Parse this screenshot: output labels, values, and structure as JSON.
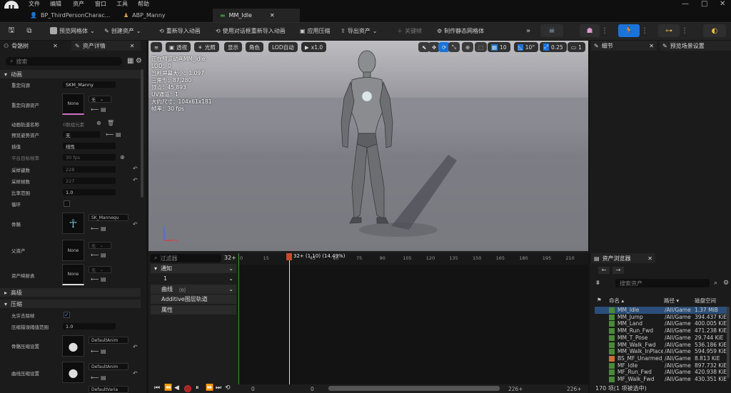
{
  "menubar": {
    "items": [
      "文件",
      "编辑",
      "资产",
      "窗口",
      "工具",
      "帮助"
    ]
  },
  "tabs": [
    {
      "label": "BP_ThirdPersonCharac..."
    },
    {
      "label": "ABP_Manny"
    },
    {
      "label": "MM_Idle"
    }
  ],
  "toolbar": {
    "preview_mesh": "预览网格体",
    "create_asset": "创建资产",
    "reimport": "重新导入动画",
    "reimport_dialog": "使用对话框重新导入动画",
    "apply_compression": "应用压缩",
    "export_asset": "导出资产",
    "add_key": "关键帧",
    "make_static_mesh": "制作静态网格体"
  },
  "left_panel": {
    "tab1": "骨骼树",
    "tab2": "资产详情",
    "search_placeholder": "搜索",
    "sections": {
      "animation": "动画",
      "advanced": "高级",
      "compression": "压缩"
    },
    "rows": {
      "retarget_source": "重定向源",
      "retarget_source_val": "SKM_Manny",
      "retarget_source_asset": "重定向源资产",
      "none": "None",
      "none_dd": "无",
      "anim_track_names": "动画轨道名称",
      "anim_track_val": "0数组元素",
      "preview_pose_asset": "预览姿势资产",
      "preview_pose_val": "无",
      "interpolation": "插值",
      "interpolation_val": "线性",
      "platform_target_frame_rate": "平台目标帧率",
      "platform_frame_val": "30 fps",
      "sampled_keys": "采样键数",
      "sampled_keys_val": "228",
      "sampled_frames": "采样帧数",
      "sampled_frames_val": "227",
      "rate_scale": "比率范围",
      "rate_scale_val": "1.0",
      "loop": "循环",
      "skeleton": "骨骼",
      "skeleton_val": "SK_Mannequ",
      "parent_asset": "父资产",
      "asset_mapping": "资产映射表",
      "allow_frame_stripping": "允许去除帧",
      "compression_error_threshold": "压缩错误阈值范围",
      "compression_error_val": "1.0",
      "bone_compression": "骨骼压缩设置",
      "bone_compression_val": "DefaultAnim",
      "curve_compression": "曲线压缩设置",
      "curve_compression_val": "DefaultAnim",
      "variable_compression_val": "DefaultVaria"
    }
  },
  "viewport": {
    "menu": "≡",
    "perspective": "透视",
    "lit": "光照",
    "show": "显示",
    "character": "角色",
    "lod": "LOD自动",
    "speed": "x1.0",
    "grid_val": "10",
    "angle_val": "10°",
    "scale_val": "0.25",
    "cam_val": "1",
    "info": [
      "正在预览动画MM_Idle.",
      "LOD：0",
      "当前屏幕大小：1.097",
      "三角形：87,280",
      "顶点：45,893",
      "UV通道：1",
      "大约尺寸：104x61x181",
      "帧率：30 fps"
    ]
  },
  "timeline": {
    "filter_placeholder": "过滤器",
    "frame_count": "32+",
    "notifies": "通知",
    "notify_track": "1",
    "curves": "曲线",
    "curves_count": "（0）",
    "additive_tracks": "Additive图层轨道",
    "attributes": "属性",
    "playhead": "32+ (1.10) (14.49%)",
    "ruler_ticks": [
      "0",
      "15",
      "30",
      "45",
      "60",
      "75",
      "90",
      "105",
      "120",
      "135",
      "150",
      "165",
      "180",
      "195",
      "210"
    ],
    "bottom_start": "0",
    "bottom_start2": "0",
    "bottom_end": "226+",
    "bottom_end2": "226+"
  },
  "right_panel": {
    "details_tab": "细节",
    "preview_scene_tab": "预览场景设置",
    "content_browser_tab": "资产浏览器",
    "search_placeholder": "搜索资产",
    "headers": {
      "name": "命名",
      "path": "路径",
      "disk_size": "磁盘空间"
    },
    "assets": [
      {
        "name": "MM_Idle",
        "path": "/All/Game",
        "size": "1.37 MiB",
        "selected": true
      },
      {
        "name": "MM_Jump",
        "path": "/All/Game",
        "size": "394.437 KiE"
      },
      {
        "name": "MM_Land",
        "path": "/All/Game",
        "size": "400.005 KiE"
      },
      {
        "name": "MM_Run_Fwd",
        "path": "/All/Game",
        "size": "471.238 KiE"
      },
      {
        "name": "MM_T_Pose",
        "path": "/All/Game",
        "size": "29.744 KiE"
      },
      {
        "name": "MM_Walk_Fwd",
        "path": "/All/Game",
        "size": "536.186 KiE"
      },
      {
        "name": "MM_Walk_InPlace",
        "path": "/All/Game",
        "size": "594.959 KiE"
      },
      {
        "name": "BS_MF_Unarmed_",
        "path": "/All/Game",
        "size": "8.813 KiE"
      },
      {
        "name": "MF_Idle",
        "path": "/All/Game",
        "size": "897.732 KiE"
      },
      {
        "name": "MF_Run_Fwd",
        "path": "/All/Game",
        "size": "420.938 KiE"
      },
      {
        "name": "MF_Walk_Fwd",
        "path": "/All/Game",
        "size": "430.351 KiE"
      }
    ],
    "status": "170 项(1 项被选中)"
  }
}
